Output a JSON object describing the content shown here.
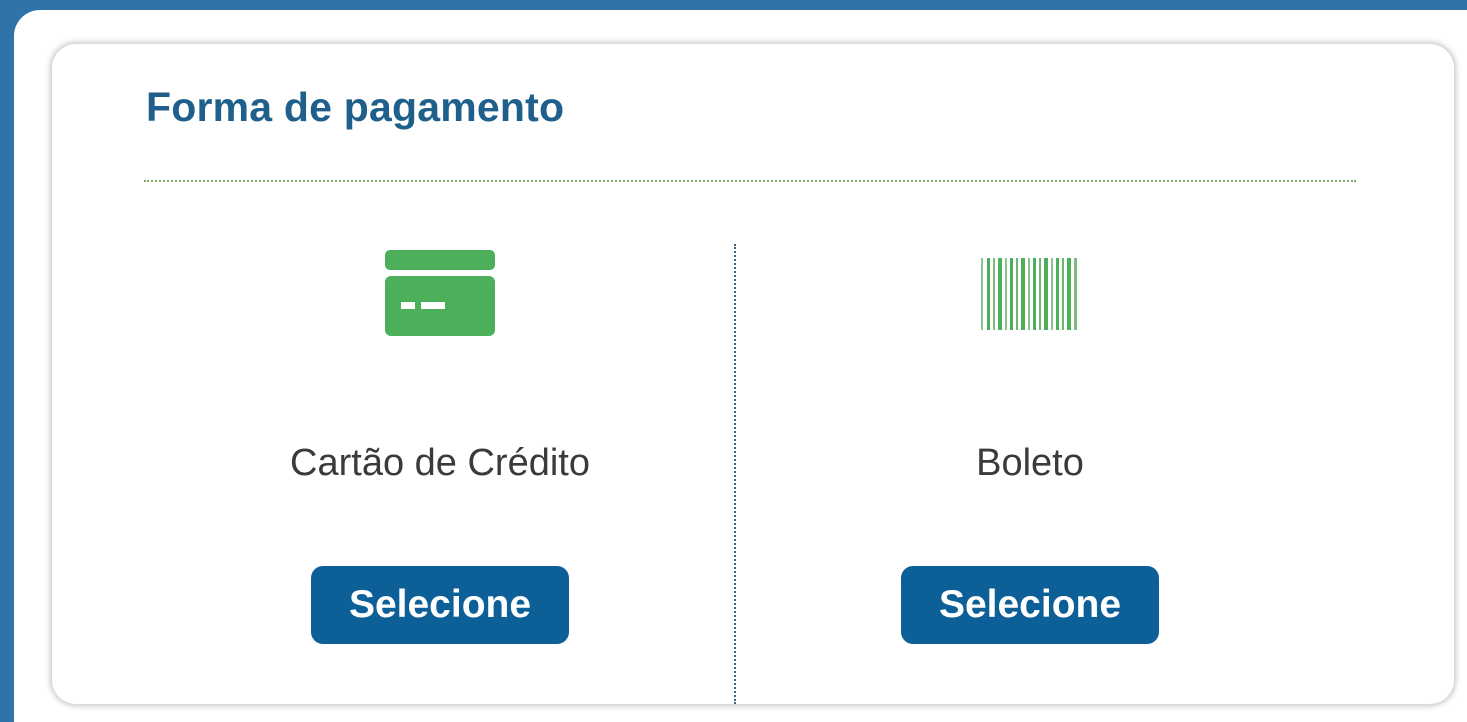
{
  "section": {
    "title": "Forma de pagamento"
  },
  "options": [
    {
      "label": "Cartão de Crédito",
      "button_label": "Selecione",
      "icon": "credit-card-icon"
    },
    {
      "label": "Boleto",
      "button_label": "Selecione",
      "icon": "barcode-icon"
    }
  ],
  "colors": {
    "background": "#2f73a8",
    "title": "#1f5f8b",
    "icon_green": "#4caf5a",
    "button": "#0d5f97"
  }
}
